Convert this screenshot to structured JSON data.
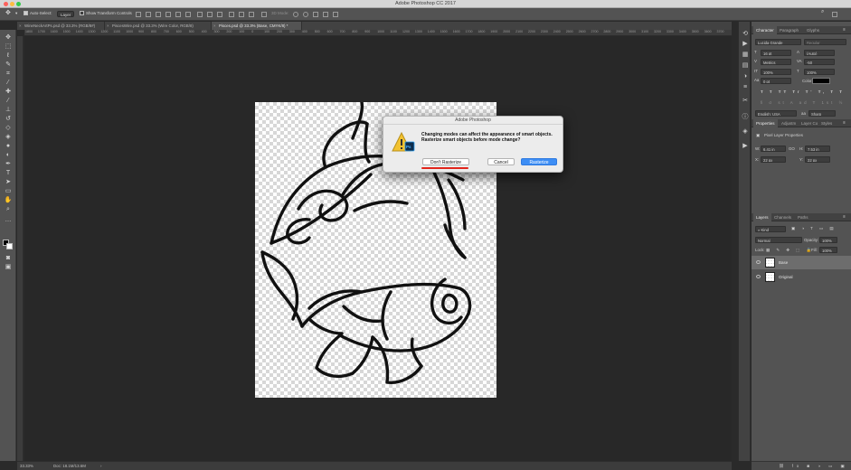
{
  "window": {
    "title": "Adobe Photoshop CC 2017"
  },
  "options_bar": {
    "auto_select_label": "Auto-Select:",
    "auto_select_value": "Layer",
    "show_transform_label": "Show Transform Controls",
    "mode_3d_label": "3D Mode:"
  },
  "tabs": [
    {
      "label": "WineNeckArtPs.psd @ 33.3% (RGB/8#)",
      "active": false
    },
    {
      "label": "PiscesWire.psd @ 33.3% (Wire Color, RGB/8)",
      "active": false
    },
    {
      "label": "Pisces.psd @ 33.3% (Base, CMYK/8) *",
      "active": true
    }
  ],
  "ruler_labels": [
    "1800",
    "1700",
    "1600",
    "1500",
    "1400",
    "1300",
    "1200",
    "1100",
    "1000",
    "900",
    "800",
    "700",
    "600",
    "500",
    "400",
    "300",
    "200",
    "100",
    "0",
    "100",
    "200",
    "300",
    "400",
    "500",
    "600",
    "700",
    "800",
    "900",
    "1000",
    "1100",
    "1200",
    "1300",
    "1400",
    "1500",
    "1600",
    "1700",
    "1800",
    "1900",
    "2000",
    "2100",
    "2200",
    "2300",
    "2400",
    "2500",
    "2600",
    "2700",
    "2800",
    "2900",
    "3000",
    "3100",
    "3200",
    "3300",
    "3400",
    "3500",
    "3600",
    "3700"
  ],
  "status_bar": {
    "zoom": "33.33%",
    "doc": "Doc: 18.1M/13.6M"
  },
  "dialog": {
    "title": "Adobe Photoshop",
    "message": "Changing modes can affect the appearance of smart objects.  Rasterize smart objects before mode change?",
    "btn_dont": "Don't Rasterize",
    "btn_cancel": "Cancel",
    "btn_rasterize": "Rasterize",
    "icon_badge": "Ps"
  },
  "character_panel": {
    "tabs": [
      "Character",
      "Paragraph",
      "Glyphs"
    ],
    "font_family": "Lucida Grande",
    "font_style": "Regular",
    "font_size": "16 pt",
    "leading": "(Auto)",
    "kerning": "Metrics",
    "tracking": "-50",
    "v_scale": "100%",
    "h_scale": "100%",
    "baseline": "0 pt",
    "color_label": "Color:",
    "language": "English: USA",
    "antialias": "Sharp"
  },
  "properties_panel": {
    "tabs": [
      "Properties",
      "Adjustm",
      "Layer Co",
      "Styles"
    ],
    "heading": "Pixel Layer Properties",
    "w_label": "W:",
    "w_value": "6.41 in",
    "go_label": "GO",
    "h_label": "H:",
    "h_value": "7.53 in",
    "x_label": "X:",
    "x_value": "22 px",
    "y_label": "Y:",
    "y_value": "22 px"
  },
  "layers_panel": {
    "tabs": [
      "Layers",
      "Channels",
      "Paths"
    ],
    "filter_label": "Kind",
    "blend_mode": "Normal",
    "opacity_label": "Opacity:",
    "opacity_value": "100%",
    "lock_label": "Lock:",
    "fill_label": "Fill:",
    "fill_value": "100%",
    "layers": [
      {
        "name": "Base",
        "selected": true
      },
      {
        "name": "Original",
        "selected": false
      }
    ]
  },
  "colors": {
    "accent_blue": "#3d8ef5",
    "annotation_red": "#e1261c",
    "ui_dark": "#535353"
  }
}
